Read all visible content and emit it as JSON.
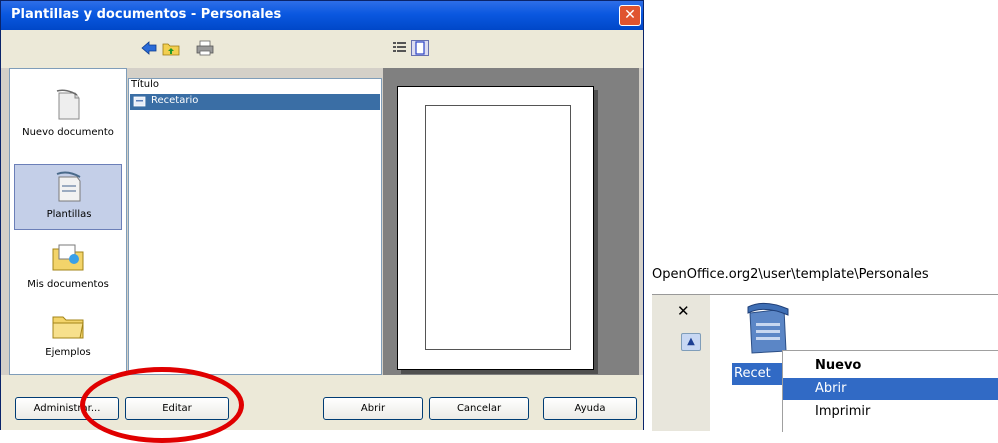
{
  "dialog": {
    "title": "Plantillas y documentos - Personales",
    "close_glyph": "✕"
  },
  "toolbar": {
    "icons": [
      "back-icon",
      "up-folder-icon",
      "print-icon",
      "document-properties-icon",
      "preview-icon"
    ]
  },
  "nav": {
    "items": [
      {
        "label": "Nuevo documento",
        "icon": "new-document-icon"
      },
      {
        "label": "Plantillas",
        "icon": "templates-icon",
        "selected": true
      },
      {
        "label": "Mis documentos",
        "icon": "my-documents-icon"
      },
      {
        "label": "Ejemplos",
        "icon": "examples-icon"
      }
    ]
  },
  "list": {
    "column_header": "Título",
    "rows": [
      {
        "label": "Recetario",
        "selected": true
      }
    ]
  },
  "buttons": {
    "administrar": "Administrar...",
    "editar": "Editar",
    "abrir": "Abrir",
    "cancelar": "Cancelar",
    "ayuda": "Ayuda"
  },
  "explorer": {
    "path": "OpenOffice.org2\\user\\template\\Personales",
    "close_glyph": "✕",
    "scroll_up_glyph": "▲",
    "file_label": "Recet"
  },
  "context_menu": {
    "items": [
      {
        "label": "Nuevo",
        "bold": true
      },
      {
        "label": "Abrir",
        "highlighted": true
      },
      {
        "label": "Imprimir"
      }
    ]
  },
  "colors": {
    "title_bar": "#0a58e0",
    "selection": "#316ac5",
    "highlight_ellipse": "#e00000"
  }
}
